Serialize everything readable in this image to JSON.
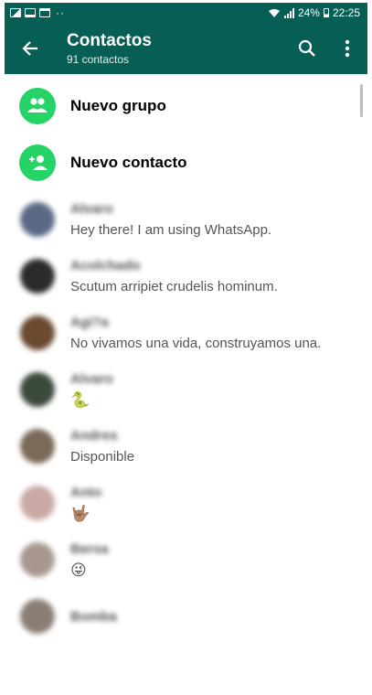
{
  "status_bar": {
    "left_icons": [
      "image-icon",
      "screen-icon",
      "calendar-icon"
    ],
    "dots": "··",
    "battery": "24%",
    "time": "22:25"
  },
  "header": {
    "title": "Contactos",
    "subtitle": "91 contactos"
  },
  "actions": {
    "new_group": "Nuevo grupo",
    "new_contact": "Nuevo contacto"
  },
  "contacts": [
    {
      "name": "Alvaro",
      "status": "Hey there! I am using WhatsApp.",
      "avatar_color": "#5a6a85"
    },
    {
      "name": "Acolchado",
      "status": "Scutum arripiet crudelis hominum.",
      "avatar_color": "#2b2b2b"
    },
    {
      "name": "Agi?a",
      "status": "No vivamos una vida, construyamos una.",
      "avatar_color": "#6b4a32"
    },
    {
      "name": "Alvaro",
      "status": "🐍",
      "avatar_color": "#3c4a3c"
    },
    {
      "name": "Andres",
      "status": "Disponible",
      "avatar_color": "#7b6a58"
    },
    {
      "name": "Anto",
      "status": "🤟🏽",
      "avatar_color": "#c9a9a4"
    },
    {
      "name": "Bersa",
      "status": "😜",
      "avatar_color": "#a89890"
    },
    {
      "name": "Bomba",
      "status": "",
      "avatar_color": "#8a7f74"
    }
  ],
  "colors": {
    "primary": "#075e54",
    "accent": "#25d366"
  }
}
